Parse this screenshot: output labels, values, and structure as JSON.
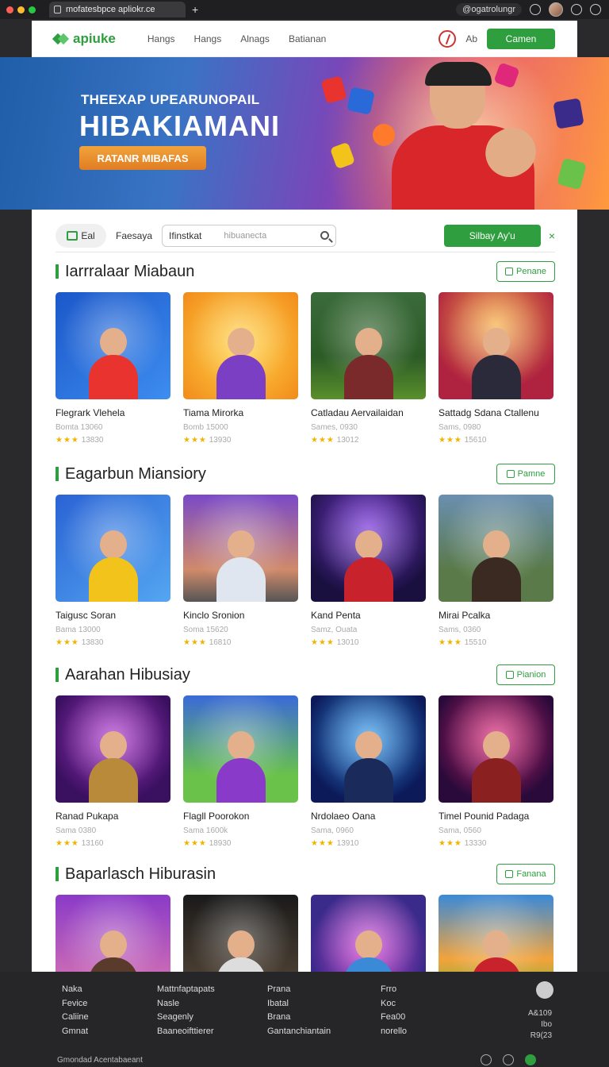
{
  "browser": {
    "tab_title": "mofatesbpce apliokr.ce",
    "address": "@ogatrolungr"
  },
  "nav": {
    "logo": "apiuke",
    "links": [
      "Hangs",
      "Hangs",
      "Alnags",
      "Batianan"
    ],
    "right_text": "Ab",
    "cta": "Camen"
  },
  "hero": {
    "subtitle": "THEEXAP UPEARUNOPAIL",
    "title": "HIBAKIAMANI",
    "button": "RATANR MIBAFAS"
  },
  "toolbar": {
    "pill": "Eal",
    "filter": "Faesaya",
    "search_value": "Ifinstkat",
    "search_placeholder": "hibuanecta",
    "green_button": "Silbay Ay'u",
    "close": "×"
  },
  "sections": [
    {
      "title": "Iarrralaar Miabaun",
      "more": "Penane",
      "cards": [
        {
          "title": "Flegrark Vlehela",
          "sub": "Bomta 13060",
          "rating": "13830"
        },
        {
          "title": "Tiama Mirorka",
          "sub": "Bomb 15000",
          "rating": "13930"
        },
        {
          "title": "Catladau Aervailaidan",
          "sub": "Sames, 0930",
          "rating": "13012"
        },
        {
          "title": "Sattadg Sdana Ctallenu",
          "sub": "Sams, 0980",
          "rating": "15610"
        }
      ]
    },
    {
      "title": "Eagarbun Miansiory",
      "more": "Pamne",
      "cards": [
        {
          "title": "Taigusc Soran",
          "sub": "Bama 13000",
          "rating": "13830"
        },
        {
          "title": "Kinclo Sronion",
          "sub": "Soma 15620",
          "rating": "16810"
        },
        {
          "title": "Kand Penta",
          "sub": "Samz, Ouata",
          "rating": "13010"
        },
        {
          "title": "Mirai Pcalka",
          "sub": "Sams, 0360",
          "rating": "15510"
        }
      ]
    },
    {
      "title": "Aarahan Hibusiay",
      "more": "Pianion",
      "cards": [
        {
          "title": "Ranad Pukapa",
          "sub": "Sama 0380",
          "rating": "13160"
        },
        {
          "title": "Flagll Poorokon",
          "sub": "Sama 1600k",
          "rating": "18930"
        },
        {
          "title": "Nrdolaeo Oana",
          "sub": "Sama, 0960",
          "rating": "13910"
        },
        {
          "title": "Timel Pounid Padaga",
          "sub": "Sama, 0560",
          "rating": "13330"
        }
      ]
    },
    {
      "title": "Baparlasch Hiburasin",
      "more": "Fanana",
      "cards": []
    }
  ],
  "footer": {
    "col1": [
      "Naka",
      "Fevice",
      "Caliine",
      "Gmnat"
    ],
    "col2": [
      "Mattnfaptapats",
      "Nasle",
      "Seagenly",
      "Baaneoifttierer"
    ],
    "col3": [
      "Prana",
      "Ibatal",
      "Brana",
      "Gantanchiantain"
    ],
    "col4": [
      "Frro",
      "Koc",
      "Fea00",
      "norello"
    ],
    "right": [
      "A&109",
      "Ibo",
      "R9(23"
    ],
    "copyright": "Gmondad Acentabaeant"
  }
}
